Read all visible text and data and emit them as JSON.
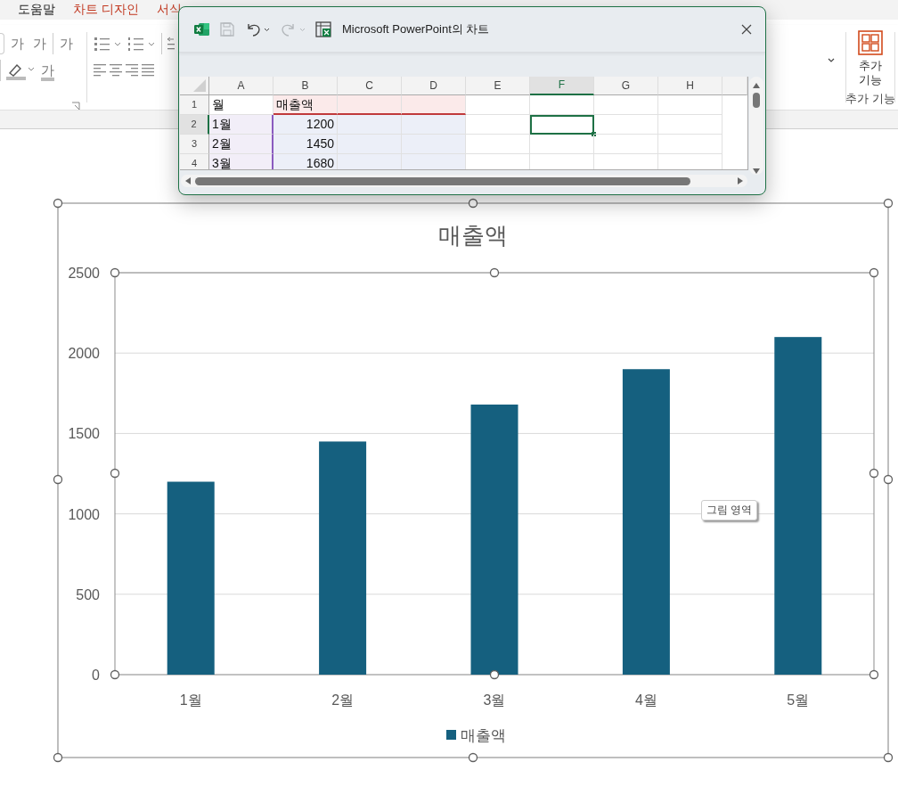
{
  "ribbon_tabs": [
    {
      "label": "도움말",
      "kind": "standard"
    },
    {
      "label": "차트 디자인",
      "kind": "contextual"
    },
    {
      "label": "서식",
      "kind": "contextual"
    }
  ],
  "ribbon": {
    "font_tools": [
      {
        "kind": "grow",
        "text": "가"
      },
      {
        "kind": "shrink",
        "text": "가"
      },
      {
        "kind": "clear",
        "text": "가"
      }
    ],
    "color_tools": [
      {
        "kind": "highlight"
      },
      {
        "kind": "font-color",
        "text": "가"
      }
    ],
    "addins_button": "추가 기능",
    "addins_group": "추가 기능"
  },
  "chart_window": {
    "title": "Microsoft PowerPoint의 차트",
    "toolbar": [
      {
        "kind": "excel"
      },
      {
        "kind": "save",
        "disabled": true
      },
      {
        "kind": "undo",
        "disabled": false
      },
      {
        "kind": "redo",
        "disabled": true
      },
      {
        "kind": "edit-in-excel"
      }
    ],
    "columns": [
      {
        "label": "A",
        "selected": false
      },
      {
        "label": "B",
        "selected": false
      },
      {
        "label": "C",
        "selected": false
      },
      {
        "label": "D",
        "selected": false
      },
      {
        "label": "E",
        "selected": false
      },
      {
        "label": "F",
        "selected": true
      },
      {
        "label": "G",
        "selected": false
      },
      {
        "label": "H",
        "selected": false
      }
    ],
    "rows": [
      {
        "number": "1",
        "selected": false,
        "cells": [
          {
            "text": "월",
            "kind": "plain"
          },
          {
            "text": "매출액",
            "kind": "name"
          },
          {
            "kind": "name"
          },
          {
            "kind": "name"
          }
        ]
      },
      {
        "number": "2",
        "selected": true,
        "cells": [
          {
            "text": "1월",
            "kind": "category"
          },
          {
            "text": "1200",
            "kind": "value"
          },
          {
            "kind": "value"
          },
          {
            "kind": "value"
          }
        ]
      },
      {
        "number": "3",
        "selected": false,
        "cells": [
          {
            "text": "2월",
            "kind": "category"
          },
          {
            "text": "1450",
            "kind": "value"
          },
          {
            "kind": "value"
          },
          {
            "kind": "value"
          }
        ]
      },
      {
        "number": "4",
        "selected": false,
        "cells": [
          {
            "text": "3월",
            "kind": "category"
          },
          {
            "text": "1680",
            "kind": "value"
          },
          {
            "kind": "value"
          },
          {
            "kind": "value"
          }
        ]
      }
    ]
  },
  "chart": {
    "chart_data": {
      "type": "bar",
      "title": "매출액",
      "categories": [
        "1월",
        "2월",
        "3월",
        "4월",
        "5월"
      ],
      "series": [
        {
          "name": "매출액",
          "color": "#15607f",
          "values": [
            1200,
            1450,
            1680,
            1900,
            2100
          ]
        }
      ],
      "ylim": [
        0,
        2500
      ],
      "yticks": [
        0,
        500,
        1000,
        1500,
        2000,
        2500
      ],
      "grid": true
    },
    "tooltip": "그림 영역"
  }
}
